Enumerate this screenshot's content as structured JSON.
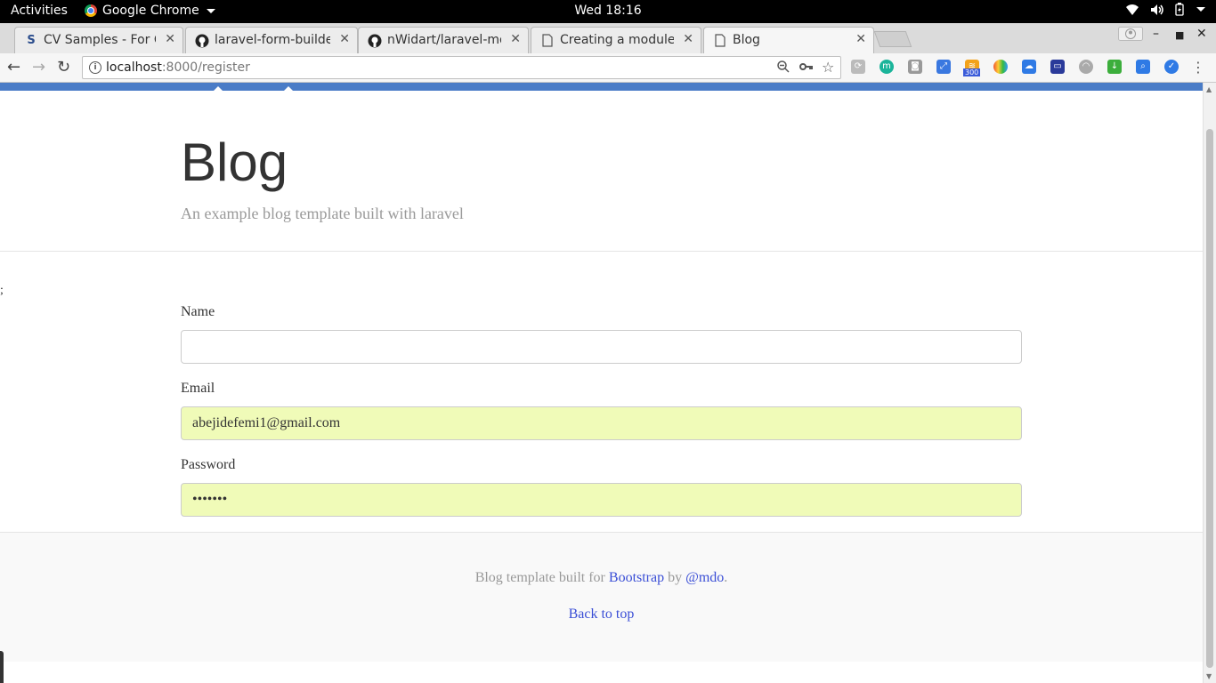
{
  "system_bar": {
    "activities": "Activities",
    "app_name": "Google Chrome",
    "clock": "Wed 18:16",
    "tray_icons": [
      "wifi-icon",
      "volume-icon",
      "battery-icon",
      "chevron-down-icon"
    ]
  },
  "tabs": [
    {
      "title": "CV Samples - For CV",
      "icon": "cv-favicon",
      "active": false
    },
    {
      "title": "laravel-form-builder",
      "icon": "github-icon",
      "active": false
    },
    {
      "title": "nWidart/laravel-mod",
      "icon": "github-icon",
      "active": false
    },
    {
      "title": "Creating a module |",
      "icon": "page-icon",
      "active": false
    },
    {
      "title": "Blog",
      "icon": "page-icon",
      "active": true
    }
  ],
  "toolbar": {
    "url_host": "localhost",
    "url_path": ":8000/register",
    "extension_badge": "300"
  },
  "colors": {
    "navbar": "#4a7cc7",
    "autofill": "#f0fbb8",
    "link": "#3b4fd6"
  },
  "blog": {
    "title": "Blog",
    "description": "An example blog template built with laravel"
  },
  "stray_text": ";",
  "form": {
    "name_label": "Name",
    "name_value": "",
    "email_label": "Email",
    "email_value": "abejidefemi1@gmail.com",
    "password_label": "Password",
    "password_value": "•••••••"
  },
  "footer": {
    "credit_prefix": "Blog template built for",
    "bootstrap_link": "Bootstrap",
    "by": "by",
    "mdo_link": "@mdo",
    "period": ".",
    "back_to_top": "Back to top"
  }
}
